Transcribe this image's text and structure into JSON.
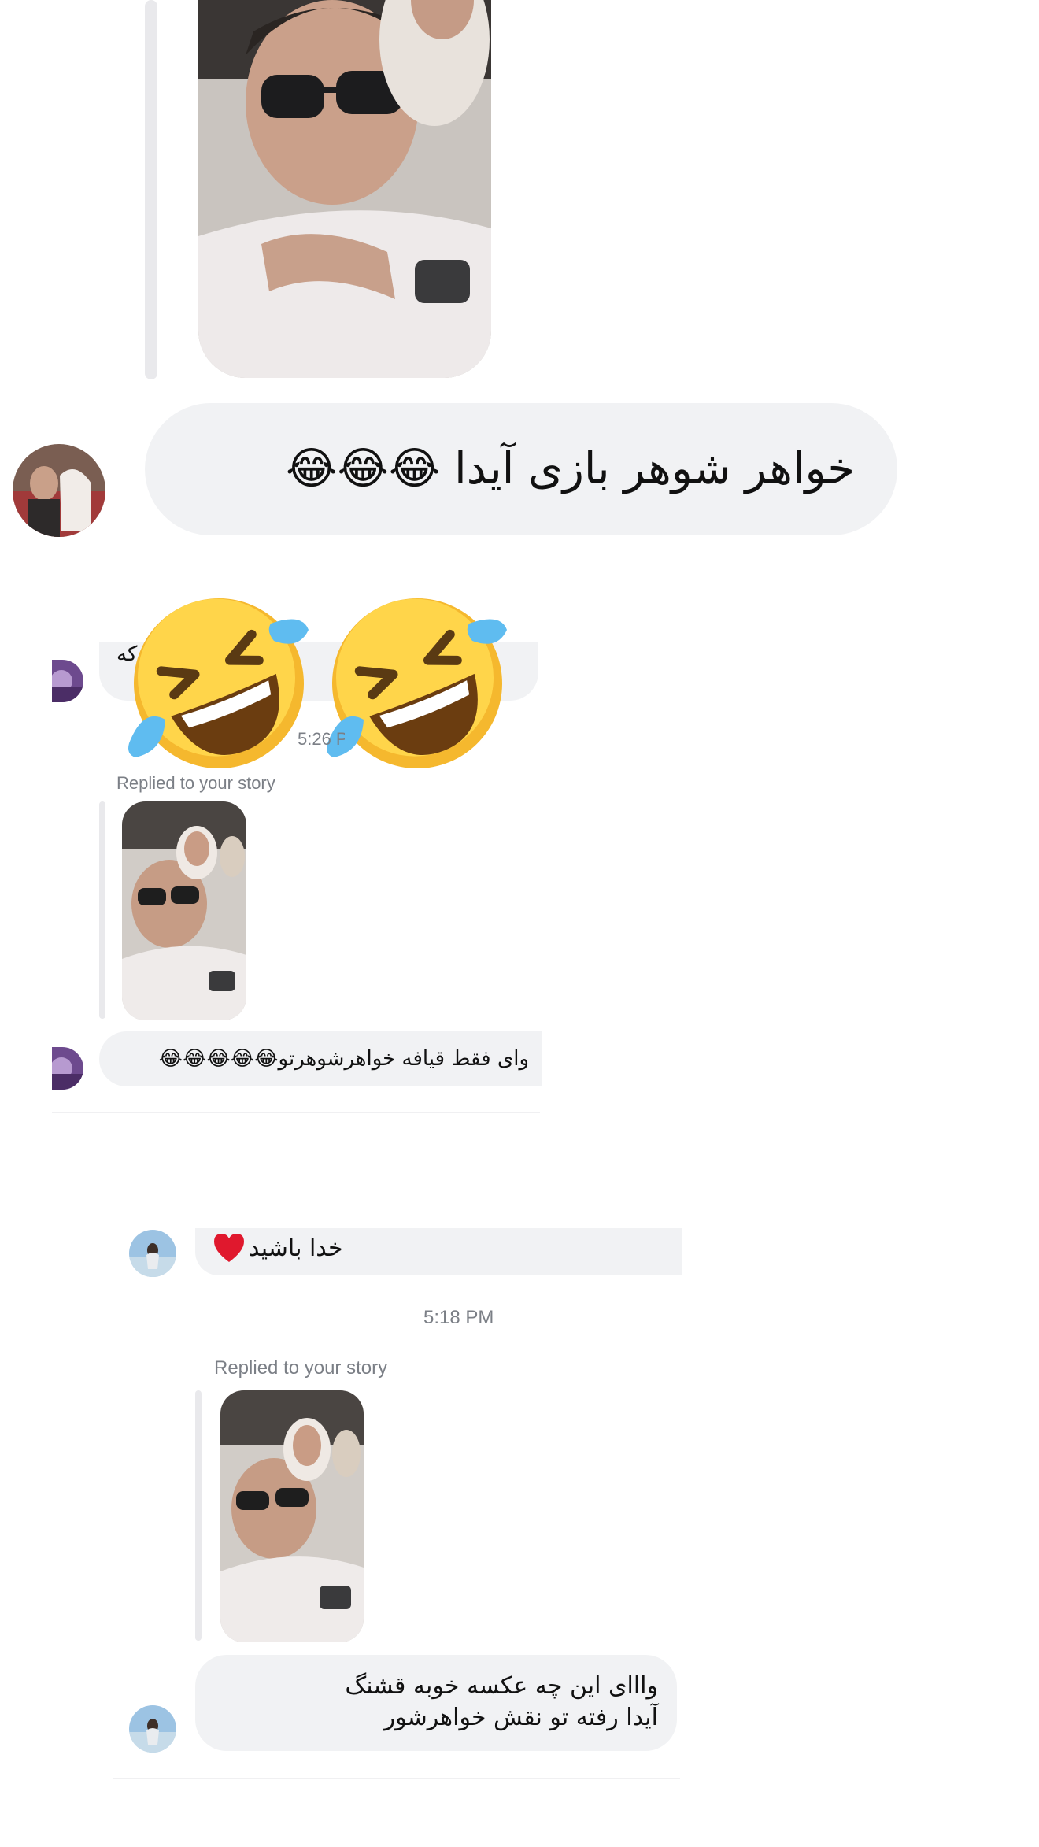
{
  "section_top": {
    "message_text": "خواهر شوهر بازی آیدا 😂😂😂"
  },
  "section_middle": {
    "partial_text_line1": "ه که",
    "partial_text_line2": "خ",
    "timestamp": "5:26 PM",
    "reply_label": "Replied to your story",
    "message_text": "وای فقط قیافه خواهرشوهرتو😂😂😂😂😂"
  },
  "section_bottom": {
    "top_message": "خدا باشید",
    "timestamp": "5:18 PM",
    "reply_label": "Replied to your story",
    "message_text": "وااای این چه عکسه خوبه قشنگ آیدا رفته تو نقش خواهرشور"
  },
  "icons": {
    "heart": "red-heart-icon",
    "laugh": "rolling-on-floor-laughing-icon"
  },
  "colors": {
    "bubble": "#f1f2f4",
    "meta_text": "#7b7f86",
    "heart": "#e0182d"
  }
}
